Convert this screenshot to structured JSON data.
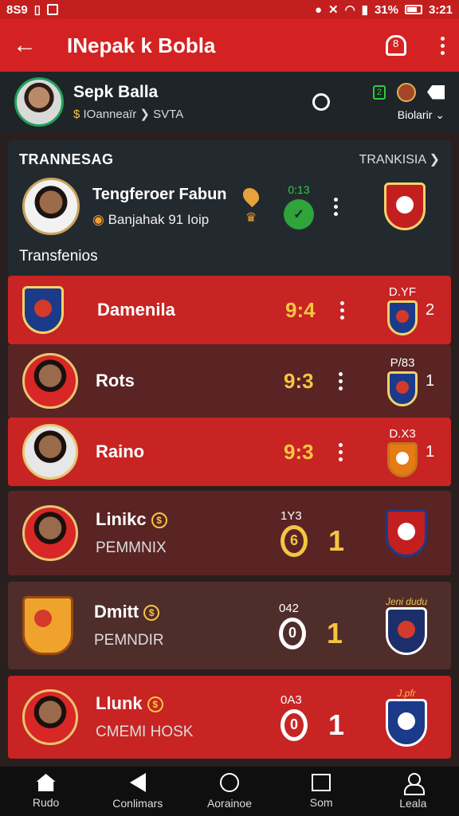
{
  "status": {
    "left": "8S9",
    "battery": "31%",
    "time": "3:21"
  },
  "appbar": {
    "title": "INepak k Bobla"
  },
  "profile": {
    "name": "Sepk Balla",
    "sub_prefix": "IOanneaïr",
    "sub_suffix": "SVTA",
    "lang": "Biolarir",
    "badge": "2"
  },
  "card": {
    "title": "TRANNESAG",
    "link": "TRANKISIA",
    "featured": {
      "name": "Tengferoer Fabun",
      "sub": "Banjahak 91 Ioip",
      "score_label": "0:13"
    },
    "section_label": "Transfenios"
  },
  "rows": [
    {
      "name": "Damenila",
      "score": "9:4",
      "code": "D.YF",
      "count": "2"
    },
    {
      "name": "Rots",
      "score": "9:3",
      "code": "P/83",
      "count": "1"
    },
    {
      "name": "Raino",
      "score": "9:3",
      "code": "D.X3",
      "count": "1"
    }
  ],
  "rows2": [
    {
      "name": "Linikc",
      "sub": "PEMMNIX",
      "time": "1Y3",
      "ring": "6",
      "num": "1"
    },
    {
      "name": "Dmitt",
      "sub": "PEMNDIR",
      "time": "042",
      "ring": "0",
      "num": "1",
      "script": "Jeni dudu"
    },
    {
      "name": "Llunk",
      "sub": "CMEMI HOSK",
      "time": "0A3",
      "ring": "0",
      "num": "1",
      "script": "J.pfr"
    }
  ],
  "nav": [
    {
      "label": "Rudo",
      "icon": "home-icon"
    },
    {
      "label": "Conlimars",
      "icon": "back-icon"
    },
    {
      "label": "Aorainoe",
      "icon": "circle-icon"
    },
    {
      "label": "Som",
      "icon": "square-icon"
    },
    {
      "label": "Leala",
      "icon": "user-icon"
    }
  ]
}
